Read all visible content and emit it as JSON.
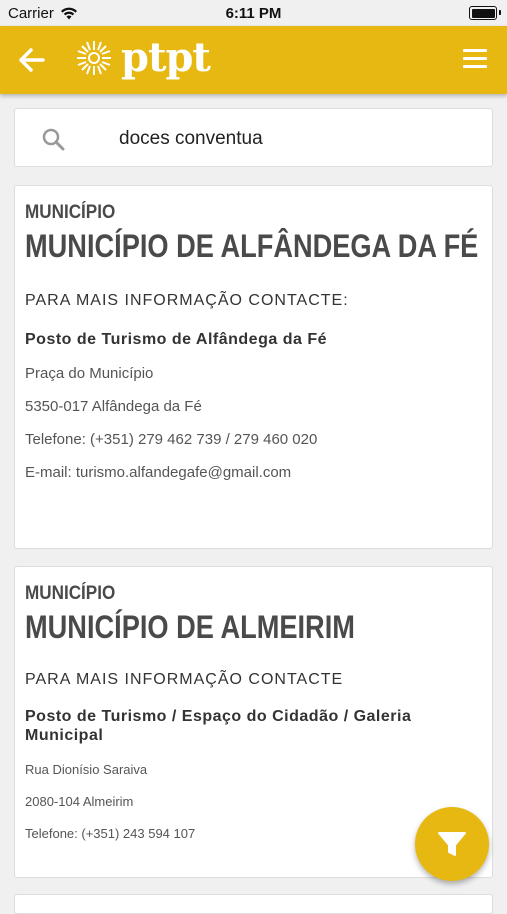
{
  "status_bar": {
    "carrier": "Carrier",
    "time": "6:11 PM"
  },
  "header": {
    "logo_text": "ptpt",
    "back_icon": "arrow-left-icon",
    "menu_icon": "hamburger-menu-icon",
    "background_color": "#e7b812"
  },
  "search": {
    "value": "doces conventua",
    "icon": "search-icon"
  },
  "results": [
    {
      "category": "MUNICÍPIO",
      "title": "MUNICÍPIO DE ALFÂNDEGA DA FÉ",
      "contact_heading": "PARA MAIS INFORMAÇÃO CONTACTE:",
      "office": "Posto de Turismo de Alfândega da Fé",
      "address": "Praça do Município",
      "postal": "5350-017 Alfândega da Fé",
      "phone": "Telefone: (+351) 279 462 739 / 279 460 020",
      "email": "E-mail: turismo.alfandegafe@gmail.com"
    },
    {
      "category": "MUNICÍPIO",
      "title": "MUNICÍPIO DE ALMEIRIM",
      "contact_heading": "PARA MAIS INFORMAÇÃO CONTACTE",
      "office": "Posto de Turismo / Espaço do Cidadão / Galeria Municipal",
      "address": "Rua Dionísio Saraiva",
      "postal": "2080-104 Almeirim",
      "phone": "Telefone: (+351) 243 594 107"
    }
  ],
  "fab": {
    "icon": "filter-icon",
    "color": "#e7b812"
  }
}
